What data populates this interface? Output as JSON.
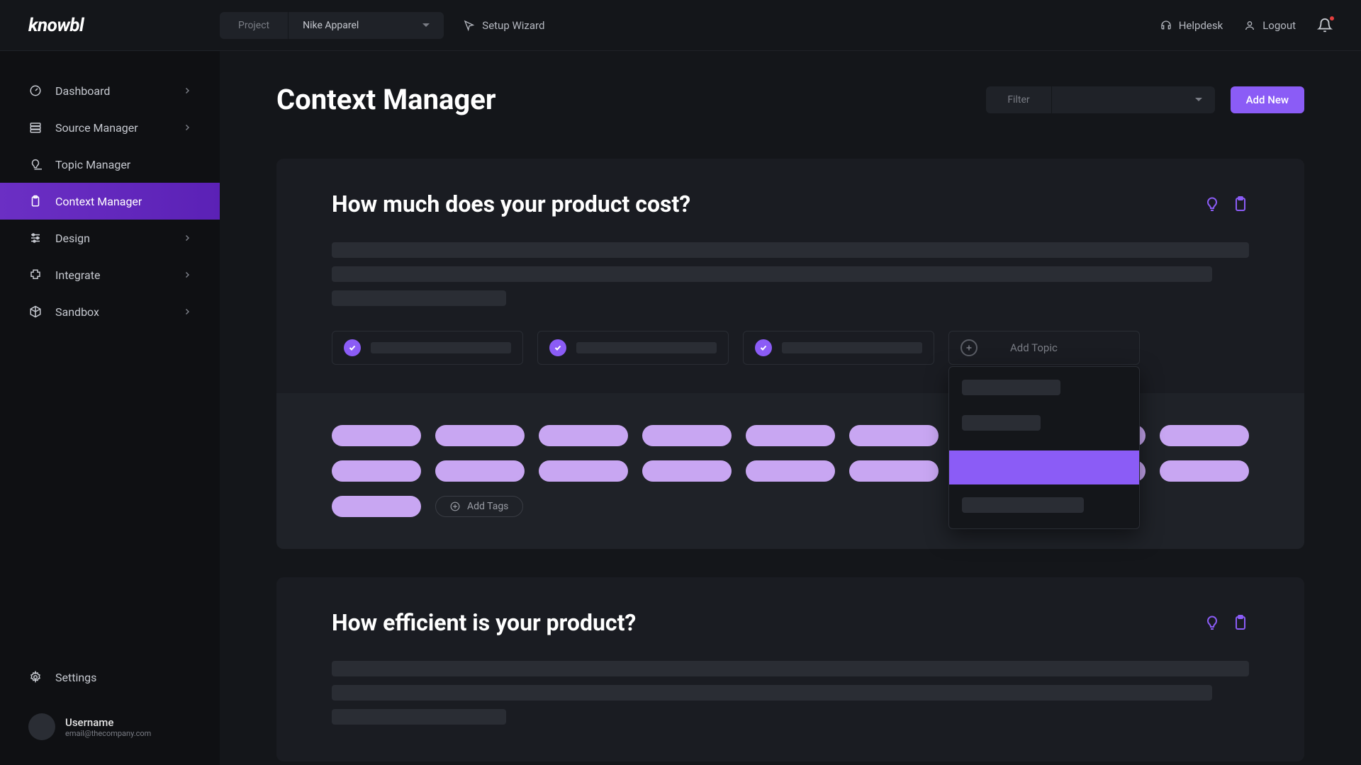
{
  "brand": "knowbl",
  "topbar": {
    "project_label": "Project",
    "project_value": "Nike Apparel",
    "setup_wizard": "Setup Wizard",
    "helpdesk": "Helpdesk",
    "logout": "Logout"
  },
  "sidebar": {
    "items": [
      {
        "label": "Dashboard",
        "icon": "gauge",
        "expandable": true
      },
      {
        "label": "Source Manager",
        "icon": "database",
        "expandable": true
      },
      {
        "label": "Topic Manager",
        "icon": "bulb",
        "expandable": false
      },
      {
        "label": "Context Manager",
        "icon": "clipboard",
        "expandable": false,
        "active": true
      },
      {
        "label": "Design",
        "icon": "sliders",
        "expandable": true
      },
      {
        "label": "Integrate",
        "icon": "puzzle",
        "expandable": true
      },
      {
        "label": "Sandbox",
        "icon": "cube",
        "expandable": true
      }
    ],
    "settings": "Settings",
    "username": "Username",
    "email": "email@thecompany.com"
  },
  "page": {
    "title": "Context Manager",
    "filter_label": "Filter",
    "add_new": "Add New"
  },
  "cards": [
    {
      "title": "How much does your product cost?",
      "text_lines_widths": [
        100,
        96,
        19
      ],
      "topics": [
        true,
        true,
        true
      ],
      "add_topic_label": "Add Topic",
      "tag_rows": [
        [
          126,
          126,
          126,
          126,
          126,
          126,
          126,
          126
        ],
        [
          126,
          126,
          126,
          126,
          126,
          126,
          126,
          126
        ],
        [
          126,
          126,
          126
        ]
      ],
      "add_tags_label": "Add Tags",
      "show_dropdown": true
    },
    {
      "title": "How efficient is your product?",
      "text_lines_widths": [
        100,
        96,
        19
      ]
    }
  ],
  "colors": {
    "accent": "#8b5cf6",
    "accent_light": "#c8a6f2",
    "bg": "#14161a",
    "surface": "#1a1c22",
    "surface2": "#1f2228"
  }
}
